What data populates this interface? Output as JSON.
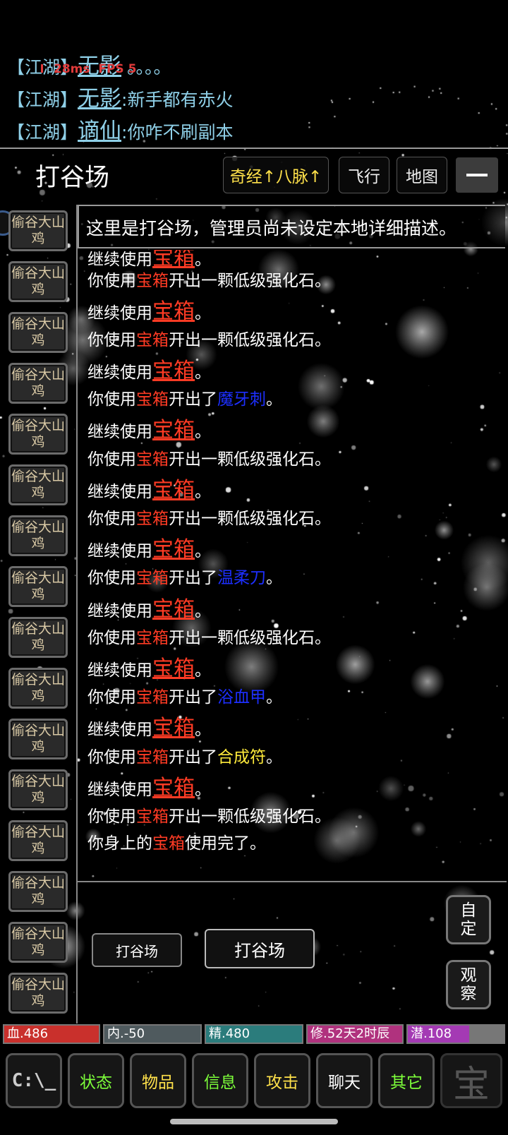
{
  "status": {
    "ping": "28ms",
    "fps": "FPS 5"
  },
  "chat": [
    {
      "tag": "【江湖】",
      "name": "无影",
      "msg": "。。。。"
    },
    {
      "tag": "【江湖】",
      "name": "无影",
      "msg": ":新手都有赤火"
    },
    {
      "tag": "【江湖】",
      "name": "谪仙",
      "msg": ":你咋不刷副本"
    }
  ],
  "room": {
    "title": "打谷场",
    "desc": "这里是打谷场，管理员尚未设定本地详细描述。",
    "buttons": {
      "qijing": "奇经↑八脉↑",
      "fly": "飞行",
      "map": "地图"
    }
  },
  "npcs": [
    "偷谷大山鸡",
    "偷谷大山鸡",
    "偷谷大山鸡",
    "偷谷大山鸡",
    "偷谷大山鸡",
    "偷谷大山鸡",
    "偷谷大山鸡",
    "偷谷大山鸡",
    "偷谷大山鸡",
    "偷谷大山鸡",
    "偷谷大山鸡",
    "偷谷大山鸡",
    "偷谷大山鸡",
    "偷谷大山鸡",
    "偷谷大山鸡",
    "偷谷大山鸡"
  ],
  "log": {
    "use_open": "你使用",
    "box": "宝箱",
    "out_stone": "开出一颗低级强化石。",
    "out_le": "开出了",
    "period": "。",
    "continue": "继续使用",
    "item1": "魔牙刺",
    "item2": "温柔刀",
    "item3": "浴血甲",
    "item4": "合成符",
    "body_pre": "你身上的",
    "used_up": "使用完了。"
  },
  "exits": {
    "exit1": "打谷场",
    "exit2": "打谷场"
  },
  "side": {
    "custom": "自\n定",
    "observe": "观\n察"
  },
  "stats": {
    "hp": "血.486",
    "neili": "内.-50",
    "jing": "精.480",
    "xiu": "修.52天2时辰",
    "qian": "潜.108"
  },
  "tabs": {
    "terminal": "C:\\_",
    "status": "状态",
    "items": "物品",
    "info": "信息",
    "attack": "攻击",
    "chat": "聊天",
    "other": "其它",
    "extra": "宝"
  },
  "colors": {
    "hp": "#c9302c",
    "neili": "#4f5a5e",
    "jing": "#2b7c7c",
    "xiu": "#b0327e",
    "qian": "#a43ab4"
  }
}
